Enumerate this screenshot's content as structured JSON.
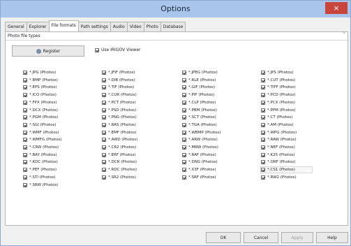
{
  "window": {
    "title": "Options",
    "close_glyph": "×"
  },
  "tabs": [
    {
      "label": "General"
    },
    {
      "label": "Explorer"
    },
    {
      "label": "File formats"
    },
    {
      "label": "Path settings"
    },
    {
      "label": "Audio"
    },
    {
      "label": "Video"
    },
    {
      "label": "Photo"
    },
    {
      "label": "Database"
    }
  ],
  "active_tab": "File formats",
  "section": {
    "label": "Photo file types",
    "collapse_glyph": "˅"
  },
  "register_button": {
    "label": "Register",
    "icon": "shield-icon"
  },
  "viewer_option": {
    "label": "Use IRIGOV Viewer",
    "checked": true
  },
  "columns": [
    [
      {
        "label": "*.JPG (Photos)",
        "checked": true
      },
      {
        "label": "*.BMP (Photos)",
        "checked": true
      },
      {
        "label": "*.EPS (Photos)",
        "checked": true
      },
      {
        "label": "*.ICO (Photos)",
        "checked": true
      },
      {
        "label": "*.FPX (Photos)",
        "checked": true
      },
      {
        "label": "*.DCX (Photos)",
        "checked": true
      },
      {
        "label": "*.PGM (Photos)",
        "checked": true
      },
      {
        "label": "*.SGI (Photos)",
        "checked": true
      },
      {
        "label": "*.WMF (Photos)",
        "checked": true
      },
      {
        "label": "*.WMFG (Photos)",
        "checked": true
      },
      {
        "label": "*.CRW (Photos)",
        "checked": true
      },
      {
        "label": "*.BAY (Photos)",
        "checked": true
      },
      {
        "label": "*.KDC (Photos)",
        "checked": true
      },
      {
        "label": "*.PEF (Photos)",
        "checked": true
      },
      {
        "label": "*.STI (Photos)",
        "checked": true
      },
      {
        "label": "*.SRW (Photos)",
        "checked": true
      }
    ],
    [
      {
        "label": "*.JFIF (Photos)",
        "checked": true
      },
      {
        "label": "*.DIB (Photos)",
        "checked": true
      },
      {
        "label": "*.TIF (Photos)",
        "checked": true
      },
      {
        "label": "*.CUR (Photos)",
        "checked": true
      },
      {
        "label": "*.PCT (Photos)",
        "checked": true
      },
      {
        "label": "*.PSD (Photos)",
        "checked": true
      },
      {
        "label": "*.PNG (Photos)",
        "checked": true
      },
      {
        "label": "*.RAS (Photos)",
        "checked": true
      },
      {
        "label": "*.EMF (Photos)",
        "checked": true
      },
      {
        "label": "*.AWD (Photos)",
        "checked": true
      },
      {
        "label": "*.CR2 (Photos)",
        "checked": true
      },
      {
        "label": "*.ERF (Photos)",
        "checked": true
      },
      {
        "label": "*.DCR (Photos)",
        "checked": true
      },
      {
        "label": "*.RDC (Photos)",
        "checked": true
      },
      {
        "label": "*.SR2 (Photos)",
        "checked": true
      }
    ],
    [
      {
        "label": "*.JPEG (Photos)",
        "checked": true
      },
      {
        "label": "*.RLE (Photos)",
        "checked": true
      },
      {
        "label": "*.GIF (Photos)",
        "checked": true
      },
      {
        "label": "*.PIF (Photos)",
        "checked": true
      },
      {
        "label": "*.CLP (Photos)",
        "checked": true
      },
      {
        "label": "*.PBM (Photos)",
        "checked": true
      },
      {
        "label": "*.SCT (Photos)",
        "checked": true
      },
      {
        "label": "*.TGA (Photos)",
        "checked": true
      },
      {
        "label": "*.WBMP (Photos)",
        "checked": true
      },
      {
        "label": "*.ARW (Photos)",
        "checked": true
      },
      {
        "label": "*.MRW (Photos)",
        "checked": true
      },
      {
        "label": "*.RAF (Photos)",
        "checked": true
      },
      {
        "label": "*.DNG (Photos)",
        "checked": true
      },
      {
        "label": "*.X3F (Photos)",
        "checked": true
      },
      {
        "label": "*.SRF (Photos)",
        "checked": true
      }
    ],
    [
      {
        "label": "*.JPS (Photos)",
        "checked": true
      },
      {
        "label": "*.CUT (Photos)",
        "checked": true
      },
      {
        "label": "*.TIFF (Photos)",
        "checked": true
      },
      {
        "label": "*.PCD (Photos)",
        "checked": true
      },
      {
        "label": "*.PCX (Photos)",
        "checked": true
      },
      {
        "label": "*.PPM (Photos)",
        "checked": true
      },
      {
        "label": "*.CT (Photos)",
        "checked": true
      },
      {
        "label": "*.AM (Photos)",
        "checked": true
      },
      {
        "label": "*.WPG (Photos)",
        "checked": true
      },
      {
        "label": "*.RAW (Photos)",
        "checked": true
      },
      {
        "label": "*.NEF (Photos)",
        "checked": true
      },
      {
        "label": "*.K25 (Photos)",
        "checked": true
      },
      {
        "label": "*.ORF (Photos)",
        "checked": true
      },
      {
        "label": "*.CS1 (Photos)",
        "checked": true,
        "highlight": true
      },
      {
        "label": "*.RW2 (Photos)",
        "checked": true
      }
    ]
  ],
  "buttons": {
    "ok": "OK",
    "cancel": "Cancel",
    "apply": "Apply",
    "help": "Help"
  }
}
